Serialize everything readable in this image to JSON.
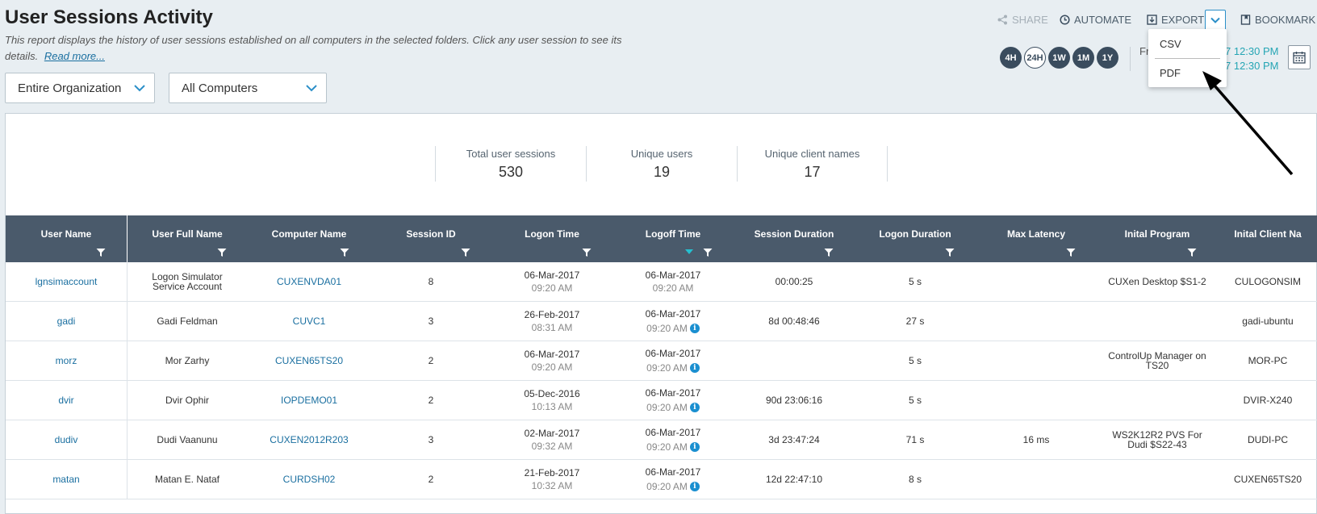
{
  "header": {
    "title": "User Sessions Activity",
    "description": "This report displays the history of user sessions established on all computers in the selected folders. Click any user session to see its details.",
    "read_more": "Read more..."
  },
  "filters": {
    "scope": "Entire Organization",
    "computers": "All Computers"
  },
  "toolbar": {
    "share": "SHARE",
    "automate": "AUTOMATE",
    "export": "EXPORT",
    "bookmark": "BOOKMARK"
  },
  "export_menu": [
    "CSV",
    "PDF"
  ],
  "time_ranges": [
    "4H",
    "24H",
    "1W",
    "1M",
    "1Y"
  ],
  "active_range": "24H",
  "date_range": {
    "label": "Fr",
    "from": "7 12:30 PM",
    "to": "7 12:30 PM"
  },
  "stats": [
    {
      "label": "Total user sessions",
      "value": "530"
    },
    {
      "label": "Unique users",
      "value": "19"
    },
    {
      "label": "Unique client names",
      "value": "17"
    }
  ],
  "columns": [
    "User Name",
    "User Full Name",
    "Computer Name",
    "Session ID",
    "Logon Time",
    "Logoff Time",
    "Session Duration",
    "Logon Duration",
    "Max Latency",
    "Inital Program",
    "Inital Client Na"
  ],
  "rows": [
    {
      "user": "lgnsimaccount",
      "full_name": "Logon Simulator Service Account",
      "computer": "CUXENVDA01",
      "session_id": "8",
      "logon_date": "06-Mar-2017",
      "logon_time": "09:20 AM",
      "logoff_date": "06-Mar-2017",
      "logoff_time": "09:20 AM",
      "logoff_info": false,
      "duration": "00:00:25",
      "logon_duration": "5 s",
      "latency": "",
      "program": "CUXen Desktop $S1-2",
      "client": "CULOGONSIM"
    },
    {
      "user": "gadi",
      "full_name": "Gadi Feldman",
      "computer": "CUVC1",
      "session_id": "3",
      "logon_date": "26-Feb-2017",
      "logon_time": "08:31 AM",
      "logoff_date": "06-Mar-2017",
      "logoff_time": "09:20 AM",
      "logoff_info": true,
      "duration": "8d 00:48:46",
      "logon_duration": "27 s",
      "latency": "",
      "program": "",
      "client": "gadi-ubuntu"
    },
    {
      "user": "morz",
      "full_name": "Mor Zarhy",
      "computer": "CUXEN65TS20",
      "session_id": "2",
      "logon_date": "06-Mar-2017",
      "logon_time": "09:20 AM",
      "logoff_date": "06-Mar-2017",
      "logoff_time": "09:20 AM",
      "logoff_info": true,
      "duration": "",
      "logon_duration": "5 s",
      "latency": "",
      "program": "ControlUp Manager on TS20",
      "client": "MOR-PC"
    },
    {
      "user": "dvir",
      "full_name": "Dvir Ophir",
      "computer": "IOPDEMO01",
      "session_id": "2",
      "logon_date": "05-Dec-2016",
      "logon_time": "10:13 AM",
      "logoff_date": "06-Mar-2017",
      "logoff_time": "09:20 AM",
      "logoff_info": true,
      "duration": "90d 23:06:16",
      "logon_duration": "5 s",
      "latency": "",
      "program": "",
      "client": "DVIR-X240"
    },
    {
      "user": "dudiv",
      "full_name": "Dudi Vaanunu",
      "computer": "CUXEN2012R203",
      "session_id": "3",
      "logon_date": "02-Mar-2017",
      "logon_time": "09:32 AM",
      "logoff_date": "06-Mar-2017",
      "logoff_time": "09:20 AM",
      "logoff_info": true,
      "duration": "3d 23:47:24",
      "logon_duration": "71 s",
      "latency": "16 ms",
      "program": "WS2K12R2 PVS For Dudi $S22-43",
      "client": "DUDI-PC"
    },
    {
      "user": "matan",
      "full_name": "Matan E. Nataf",
      "computer": "CURDSH02",
      "session_id": "2",
      "logon_date": "21-Feb-2017",
      "logon_time": "10:32 AM",
      "logoff_date": "06-Mar-2017",
      "logoff_time": "09:20 AM",
      "logoff_info": true,
      "duration": "12d 22:47:10",
      "logon_duration": "8 s",
      "latency": "",
      "program": "",
      "client": "CUXEN65TS20"
    }
  ],
  "colors": {
    "header_bg": "#4a5a6b",
    "link": "#1a6fa0",
    "accent": "#25a5b4",
    "info": "#1a8fd0"
  }
}
